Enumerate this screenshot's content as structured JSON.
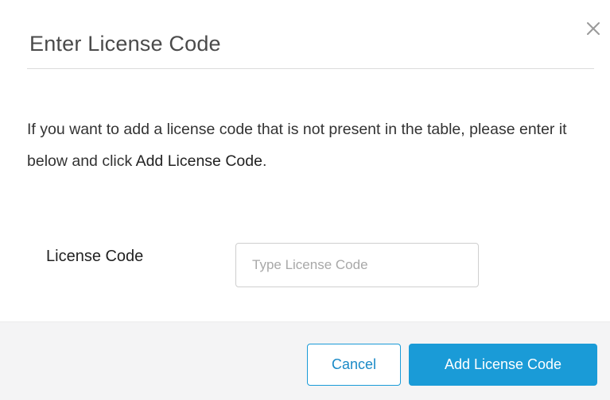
{
  "dialog": {
    "title": "Enter License Code",
    "close_icon": "close-icon",
    "message_part1": "If you want to add a license code that is not present in the table, please enter it below and click ",
    "message_emphasis": "Add License Code",
    "message_end": ".",
    "field": {
      "label": "License Code",
      "value": "",
      "placeholder": "Type License Code"
    },
    "buttons": {
      "cancel_label": "Cancel",
      "add_label": "Add License Code"
    },
    "colors": {
      "accent": "#1a9bd7",
      "footer_bg": "#f4f4f5"
    }
  }
}
